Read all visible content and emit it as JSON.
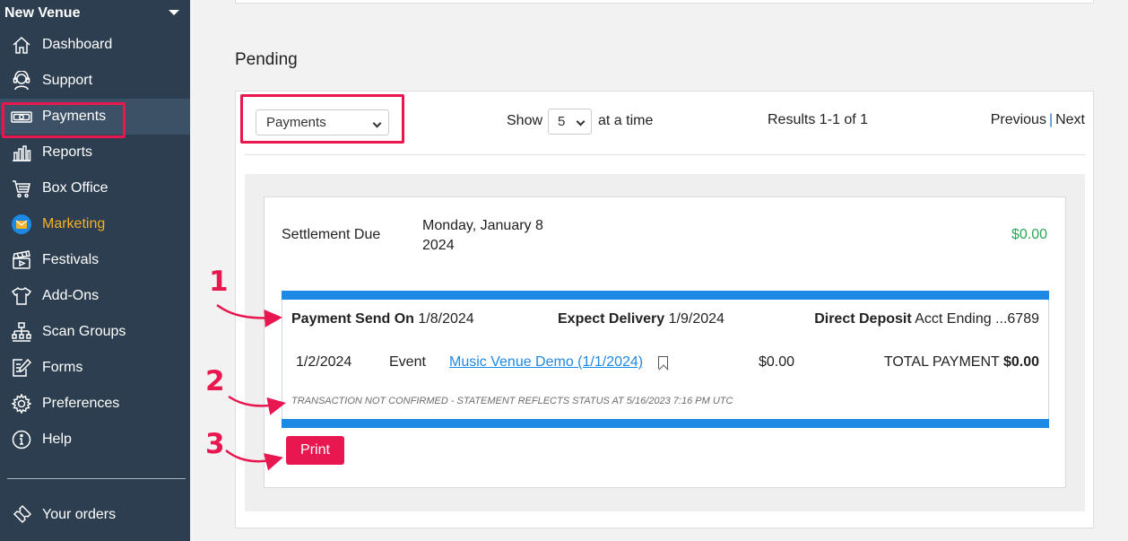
{
  "sidebar": {
    "venue": "New Venue",
    "items": [
      {
        "label": "Dashboard",
        "icon": "home-icon"
      },
      {
        "label": "Support",
        "icon": "headset-icon"
      },
      {
        "label": "Payments",
        "icon": "money-icon",
        "active": true
      },
      {
        "label": "Reports",
        "icon": "bar-chart-icon"
      },
      {
        "label": "Box Office",
        "icon": "cart-icon"
      },
      {
        "label": "Marketing",
        "icon": "mail-icon"
      },
      {
        "label": "Festivals",
        "icon": "clapperboard-icon"
      },
      {
        "label": "Add-Ons",
        "icon": "tshirt-icon"
      },
      {
        "label": "Scan Groups",
        "icon": "org-chart-icon"
      },
      {
        "label": "Forms",
        "icon": "form-edit-icon"
      },
      {
        "label": "Preferences",
        "icon": "gear-icon"
      },
      {
        "label": "Help",
        "icon": "help-icon"
      }
    ],
    "orders": "Your orders"
  },
  "main": {
    "title": "Pending",
    "filter_select": "Payments",
    "show_label": "Show",
    "per_page": "5",
    "at_time": "at a time",
    "results": "Results 1-1 of 1",
    "previous": "Previous",
    "pager_sep": "|",
    "next": "Next"
  },
  "settlement": {
    "label": "Settlement Due",
    "date_line1": "Monday, January 8",
    "date_line2": "2024",
    "amount": "$0.00"
  },
  "statement": {
    "send_label": "Payment Send On",
    "send_value": "1/8/2024",
    "delivery_label": "Expect Delivery",
    "delivery_value": "1/9/2024",
    "deposit_label": "Direct Deposit",
    "deposit_value": "Acct Ending ...6789",
    "row_date": "1/2/2024",
    "row_type": "Event",
    "row_link": "Music Venue Demo (1/1/2024)",
    "row_amount": "$0.00",
    "total_label": "TOTAL PAYMENT",
    "total_value": "$0.00",
    "note": "TRANSACTION NOT CONFIRMED - STATEMENT REFLECTS STATUS AT 5/16/2023 7:16 PM UTC"
  },
  "print_label": "Print",
  "steps": [
    "1",
    "2",
    "3"
  ],
  "colors": {
    "sidebar": "#2c3e50",
    "accent": "#e8174f",
    "link": "#1e88e5",
    "amount_green": "#2aa655",
    "marketing": "#f5b324"
  }
}
